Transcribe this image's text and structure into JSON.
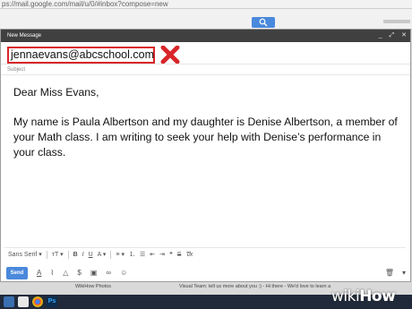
{
  "browser": {
    "url": "ps://mail.google.com/mail/u/0/#inbox?compose=new"
  },
  "compose": {
    "title": "New Message",
    "header_icons": [
      "minimize-icon",
      "expand-icon",
      "close-icon"
    ],
    "to_value": "jennaevans@abcschool.com",
    "subject_placeholder": "Subject",
    "body": {
      "greeting": "Dear Miss Evans,",
      "paragraph": "My name is Paula Albertson and my daughter is Denise Albertson, a member of your Math class.  I am writing to seek your help with Denise’s performance in your class."
    },
    "format_bar": {
      "font": "Sans Serif",
      "tools": [
        "font-size-icon",
        "bold-icon",
        "italic-icon",
        "underline-icon",
        "text-color-icon",
        "align-icon",
        "numbered-list-icon",
        "bulleted-list-icon",
        "indent-less-icon",
        "indent-more-icon",
        "quote-icon",
        "strikethrough-icon",
        "remove-formatting-icon"
      ]
    },
    "send_label": "Send"
  },
  "strip": {
    "left_label": "WikiHow Photos",
    "right_label": "Visual Team: tell us more about you :) - Hi there - We'd love to learn a little bit more about you!"
  },
  "watermark": {
    "wiki": "wiki",
    "how": "How"
  },
  "colors": {
    "header_bg": "#404040",
    "highlight_border": "#d8262a",
    "send_button": "#4a89dc",
    "taskbar": "#202a3a"
  }
}
